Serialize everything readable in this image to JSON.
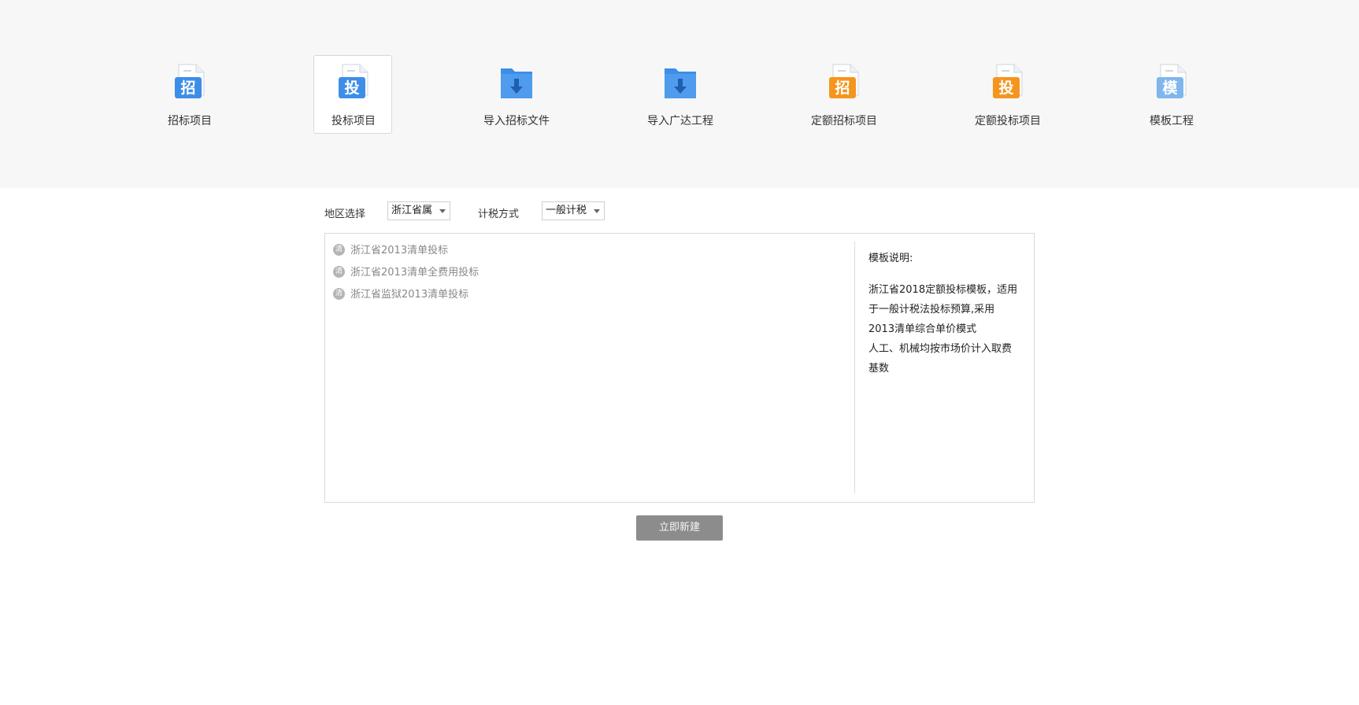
{
  "toolbar": {
    "items": [
      {
        "label": "招标项目",
        "glyph": "招",
        "icon": "bid-doc-icon",
        "color": "#3d8ee8"
      },
      {
        "label": "投标项目",
        "glyph": "投",
        "icon": "tender-doc-icon",
        "color": "#3d8ee8"
      },
      {
        "label": "导入招标文件",
        "icon": "folder-download-icon",
        "color": "#3d8ee8"
      },
      {
        "label": "导入广达工程",
        "icon": "folder-download-icon",
        "color": "#3d8ee8"
      },
      {
        "label": "定额招标项目",
        "glyph": "招",
        "icon": "quota-bid-doc-icon",
        "color": "#f5951d"
      },
      {
        "label": "定额投标项目",
        "glyph": "投",
        "icon": "quota-tender-doc-icon",
        "color": "#f5951d"
      },
      {
        "label": "模板工程",
        "glyph": "模",
        "icon": "template-doc-icon",
        "color": "#7fb6ee"
      }
    ],
    "selected_index": 1
  },
  "filters": {
    "region_label": "地区选择",
    "region_value": "浙江省属",
    "tax_label": "计税方式",
    "tax_value": "一般计税"
  },
  "templates": {
    "badge": "清",
    "items": [
      "浙江省2013清单投标",
      "浙江省2013清单全费用投标",
      "浙江省监狱2013清单投标"
    ]
  },
  "description": {
    "title": "模板说明:",
    "body": "浙江省2018定额投标模板，适用于一般计税法投标预算,采用2013清单综合单价模式\n人工、机械均按市场价计入取费基数"
  },
  "actions": {
    "create_label": "立即新建"
  },
  "colors": {
    "blue": "#3d8ee8",
    "orange": "#f5951d",
    "light_blue": "#7fb6ee",
    "button_gray": "#8c8c8c"
  }
}
